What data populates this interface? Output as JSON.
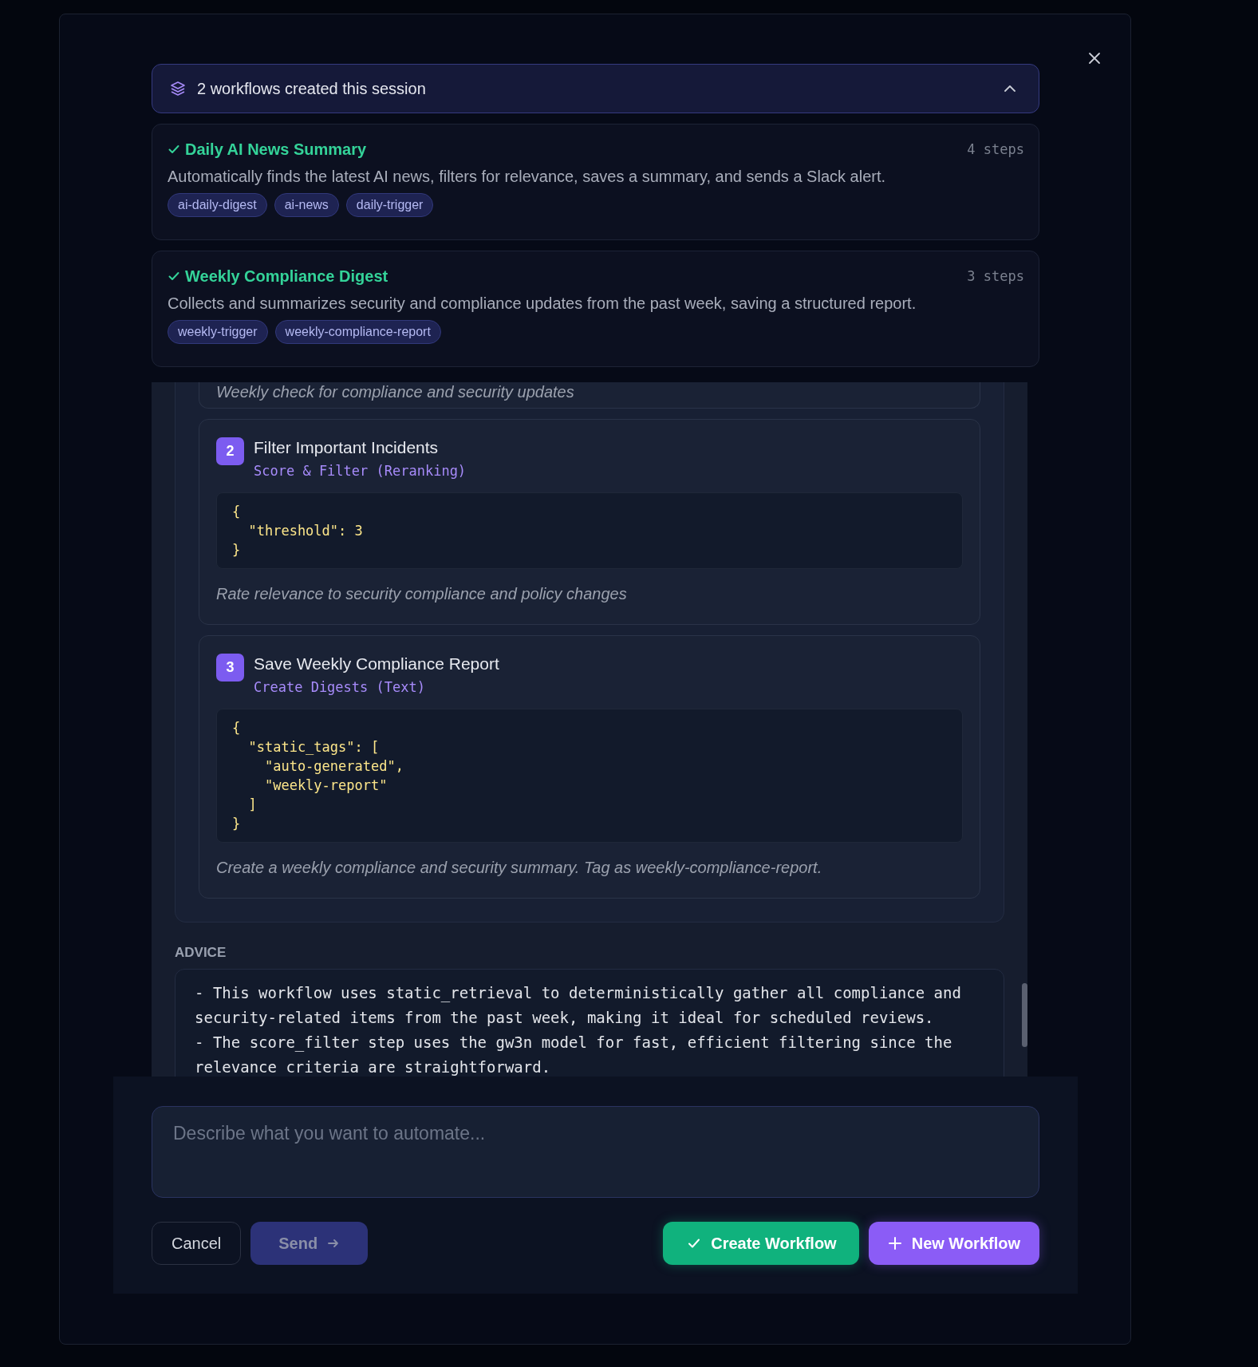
{
  "session": {
    "title": "2 workflows created this session",
    "expanded": true
  },
  "workflows": [
    {
      "name": "Daily AI News Summary",
      "steps": "4 steps",
      "description": "Automatically finds the latest AI news, filters for relevance, saves a summary, and sends a Slack alert.",
      "tags": [
        "ai-daily-digest",
        "ai-news",
        "daily-trigger"
      ]
    },
    {
      "name": "Weekly Compliance Digest",
      "steps": "3 steps",
      "description": "Collects and summarizes security and compliance updates from the past week, saving a structured report.",
      "tags": [
        "weekly-trigger",
        "weekly-compliance-report"
      ]
    }
  ],
  "previous_step_note": "Weekly check for compliance and security updates",
  "steps": [
    {
      "number": "2",
      "title": "Filter Important Incidents",
      "action": "Score & Filter (Reranking)",
      "config": "{\n  \"threshold\": 3\n}",
      "note": "Rate relevance to security compliance and policy changes"
    },
    {
      "number": "3",
      "title": "Save Weekly Compliance Report",
      "action": "Create Digests (Text)",
      "config": "{\n  \"static_tags\": [\n    \"auto-generated\",\n    \"weekly-report\"\n  ]\n}",
      "note": "Create a weekly compliance and security summary. Tag as weekly-compliance-report."
    }
  ],
  "advice": {
    "label": "ADVICE",
    "text": "- This workflow uses static_retrieval to deterministically gather all compliance and security-related items from the past week, making it ideal for scheduled reviews.\n- The score_filter step uses the gw3n model for fast, efficient filtering since the relevance criteria are straightforward."
  },
  "input": {
    "placeholder": "Describe what you want to automate..."
  },
  "buttons": [
    {
      "label": "Cancel",
      "kind": "cancel"
    },
    {
      "label": "Send",
      "kind": "send",
      "disabled": true
    },
    {
      "label": "Create Workflow",
      "kind": "create"
    },
    {
      "label": "New Workflow",
      "kind": "new"
    }
  ]
}
